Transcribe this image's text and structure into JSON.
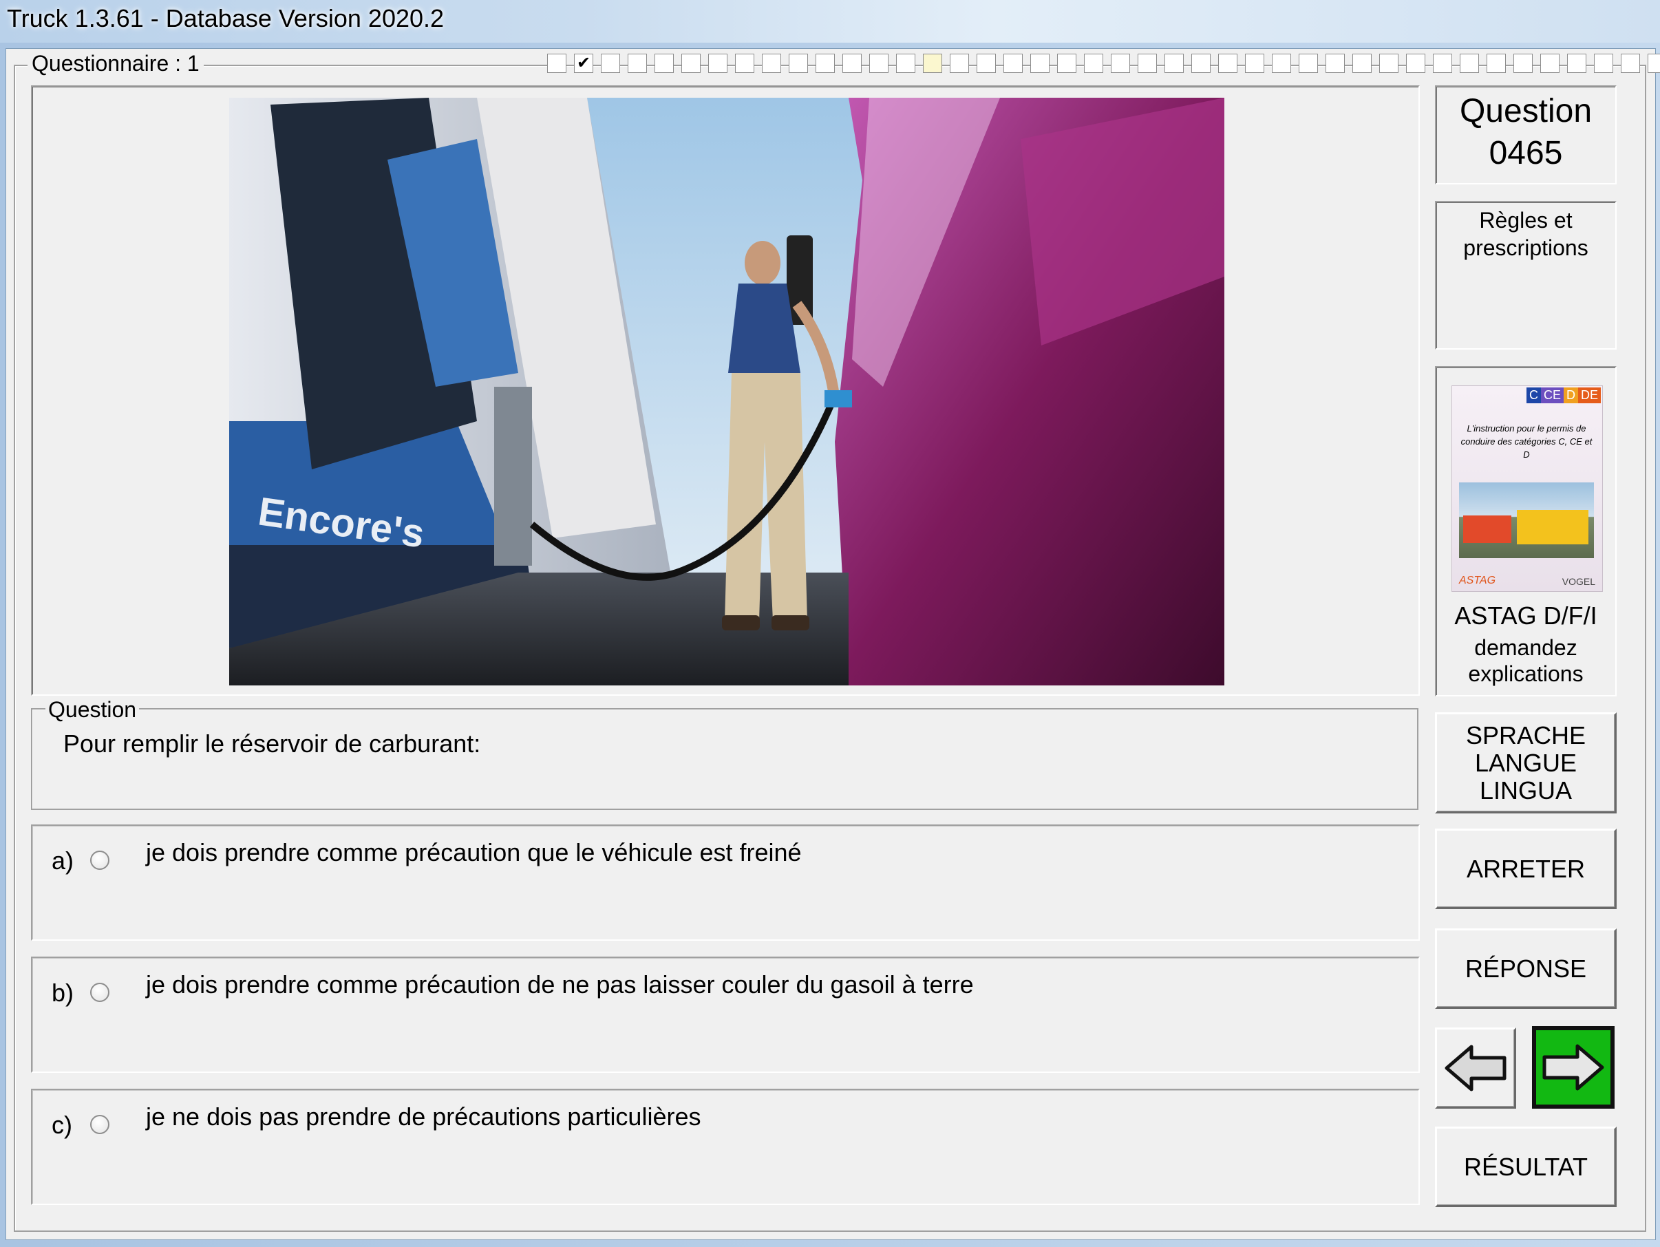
{
  "window": {
    "title": "Truck 1.3.61 - Database Version 2020.2"
  },
  "questionnaire": {
    "label": "Questionnaire : 1",
    "progress_total": 42,
    "progress_checked_index": 1,
    "progress_highlight_index": 14,
    "check_mark": "✔"
  },
  "photo": {
    "pump_brand_text": "Encore's",
    "description_colors": {
      "sky": "#bcd6ec",
      "truck": "#8a1f6b",
      "pump": "#2f5d9a"
    }
  },
  "question": {
    "legend": "Question",
    "text": "Pour remplir le réservoir de carburant:"
  },
  "answers": [
    {
      "letter": "a)",
      "text": "je dois prendre comme précaution que le véhicule est freiné"
    },
    {
      "letter": "b)",
      "text": "je dois prendre comme précaution de ne pas laisser couler du gasoil à terre"
    },
    {
      "letter": "c)",
      "text": "je ne dois pas prendre de précautions particulières"
    }
  ],
  "sidebar": {
    "question_label": "Question",
    "question_number": "0465",
    "rules_label": "Règles et\nprescriptions",
    "book": {
      "badges": [
        "C",
        "CE",
        "D",
        "DE"
      ],
      "cover_text": "L'instruction pour le permis de conduire des catégories C, CE et D",
      "publisher_left": "ASTAG",
      "publisher_right": "VOGEL"
    },
    "astag_label": "ASTAG D/F/I",
    "explain_label": "demandez\nexplications",
    "language_button": "SPRACHE\nLANGUE\nLINGUA",
    "stop_button": "ARRETER",
    "answer_button": "RÉPONSE",
    "result_button": "RÉSULTAT",
    "prev_icon": "left-arrow-icon",
    "next_icon": "right-arrow-icon",
    "next_color": "#12b812"
  }
}
